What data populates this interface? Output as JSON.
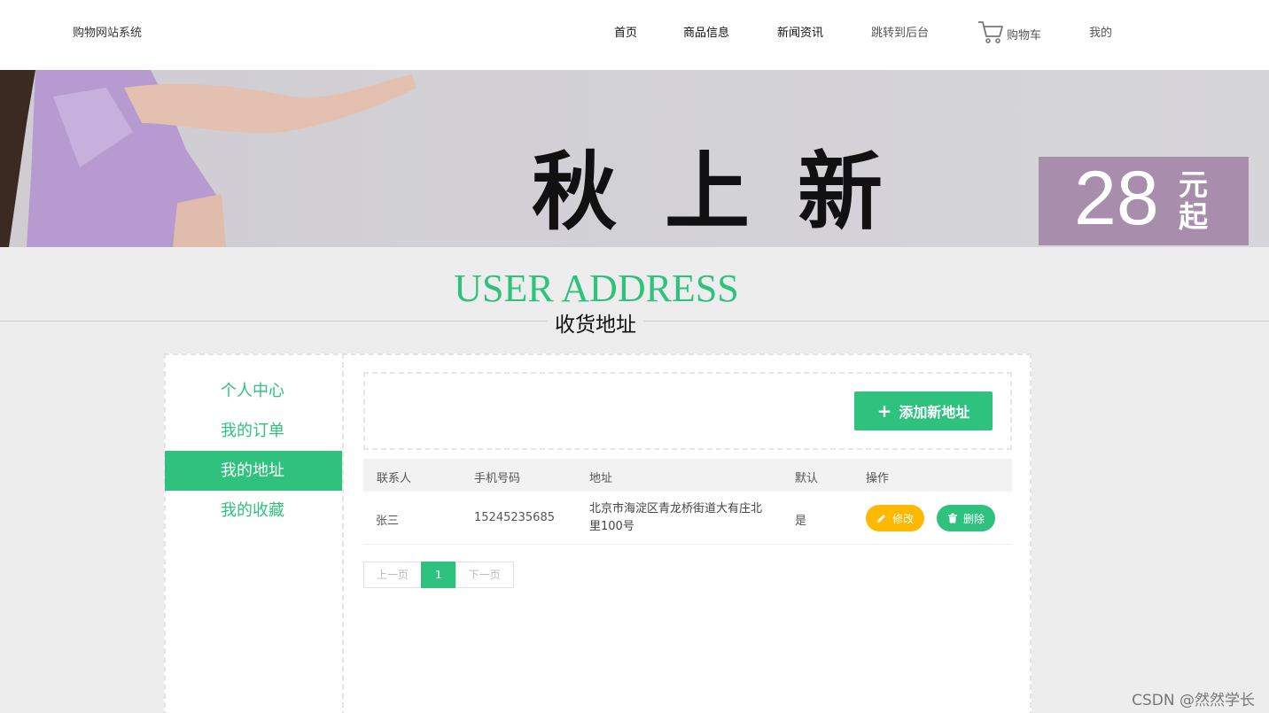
{
  "header": {
    "site_title": "购物网站系统",
    "nav": {
      "home": "首页",
      "products": "商品信息",
      "news": "新闻资讯",
      "admin": "跳转到后台",
      "cart": "购物车",
      "mine": "我的"
    }
  },
  "banner": {
    "promo_text": "秋上新",
    "price": "28",
    "price_unit": "元起",
    "accent_color": "#a88dac"
  },
  "section": {
    "title_en": "USER ADDRESS",
    "title_cn": "收货地址"
  },
  "sidebar": {
    "items": [
      {
        "label": "个人中心",
        "active": false
      },
      {
        "label": "我的订单",
        "active": false
      },
      {
        "label": "我的地址",
        "active": true
      },
      {
        "label": "我的收藏",
        "active": false
      }
    ]
  },
  "toolbar": {
    "add_label": "添加新地址"
  },
  "table": {
    "headers": [
      "联系人",
      "手机号码",
      "地址",
      "默认",
      "操作"
    ],
    "rows": [
      {
        "name": "张三",
        "phone": "15245235685",
        "address": "北京市海淀区青龙桥街道大有庄北里100号",
        "is_default": "是",
        "edit_label": "修改",
        "delete_label": "删除"
      }
    ]
  },
  "pagination": {
    "prev": "上一页",
    "current": "1",
    "next": "下一页"
  },
  "watermark": "CSDN @然然学长",
  "colors": {
    "primary": "#2ec27e",
    "warning": "#ffb800"
  }
}
